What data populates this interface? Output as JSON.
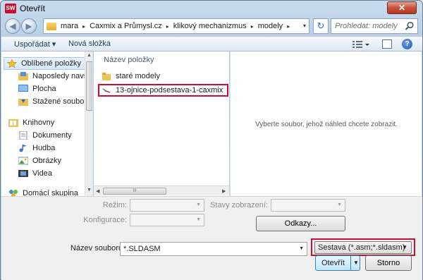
{
  "window": {
    "title": "Otevřít",
    "app_icon_text": "SW",
    "close_glyph": "✕"
  },
  "address_bar": {
    "breadcrumbs": [
      "mara",
      "Caxmix a Průmysl.cz",
      "klikový mechanizmus",
      "modely"
    ],
    "separator": "▸",
    "back_glyph": "◀",
    "forward_glyph": "▶",
    "dropdown_glyph": "▾",
    "refresh_glyph": "↻"
  },
  "search": {
    "placeholder": "Prohledat: modely"
  },
  "toolbar": {
    "organize_label": "Uspořádat ▾",
    "new_folder_label": "Nová složka",
    "help_glyph": "?"
  },
  "sidebar": {
    "items": [
      {
        "label": "Oblíbené položky",
        "icon": "star-icon"
      },
      {
        "label": "Naposledy navštív",
        "icon": "recent-places-icon"
      },
      {
        "label": "Plocha",
        "icon": "desktop-icon"
      },
      {
        "label": "Stažené soubory",
        "icon": "downloads-icon"
      },
      {
        "label": "Knihovny",
        "icon": "libraries-icon"
      },
      {
        "label": "Dokumenty",
        "icon": "documents-icon"
      },
      {
        "label": "Hudba",
        "icon": "music-icon"
      },
      {
        "label": "Obrázky",
        "icon": "pictures-icon"
      },
      {
        "label": "Videa",
        "icon": "videos-icon"
      },
      {
        "label": "Domácí skupina",
        "icon": "homegroup-icon"
      }
    ]
  },
  "file_list": {
    "column_header": "Název položky",
    "items": [
      {
        "name": "staré modely",
        "type": "folder"
      },
      {
        "name": "13-ojnice-podsestava-1-caxmix",
        "type": "assembly",
        "highlighted": true
      }
    ],
    "hscroll_grip": "III"
  },
  "preview": {
    "message": "Vyberte soubor, jehož náhled chcete zobrazit."
  },
  "options": {
    "mode_label": "Režim:",
    "configuration_label": "Konfigurace:",
    "display_states_label": "Stavy zobrazení:",
    "references_button": "Odkazy..."
  },
  "bottom": {
    "filename_label": "Název souboru:",
    "filename_value": "*.SLDASM",
    "file_type_value": "Sestava (*.asm;*.sldasm)",
    "open_button": "Otevřít",
    "cancel_button": "Storno"
  },
  "colors": {
    "highlight_border": "#c8102e",
    "accent": "#3c7fb1"
  }
}
